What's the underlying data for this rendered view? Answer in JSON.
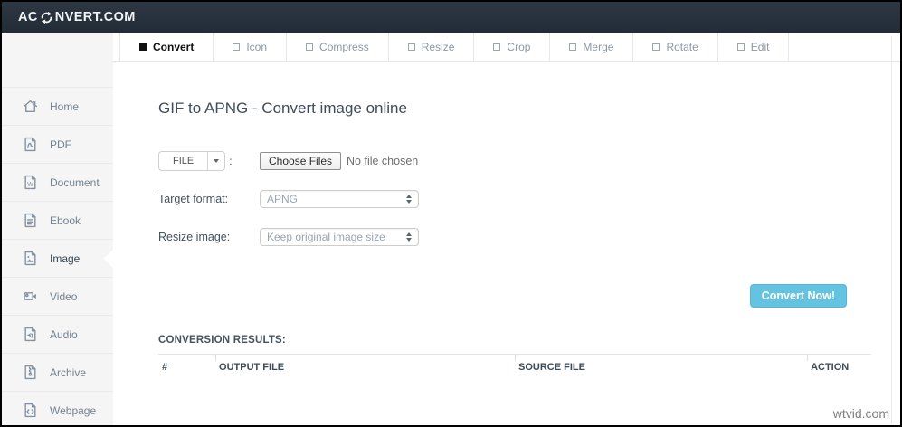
{
  "header": {
    "logo_prefix": "AC",
    "logo_suffix": "NVERT.COM"
  },
  "tabs": [
    {
      "label": "Convert",
      "active": true
    },
    {
      "label": "Icon",
      "active": false
    },
    {
      "label": "Compress",
      "active": false
    },
    {
      "label": "Resize",
      "active": false
    },
    {
      "label": "Crop",
      "active": false
    },
    {
      "label": "Merge",
      "active": false
    },
    {
      "label": "Rotate",
      "active": false
    },
    {
      "label": "Edit",
      "active": false
    }
  ],
  "sidebar": {
    "items": [
      {
        "label": "Home",
        "icon": "home-icon",
        "active": false
      },
      {
        "label": "PDF",
        "icon": "pdf-file-icon",
        "active": false
      },
      {
        "label": "Document",
        "icon": "word-document-icon",
        "active": false
      },
      {
        "label": "Ebook",
        "icon": "ebook-icon",
        "active": false
      },
      {
        "label": "Image",
        "icon": "image-file-icon",
        "active": true
      },
      {
        "label": "Video",
        "icon": "video-camera-icon",
        "active": false
      },
      {
        "label": "Audio",
        "icon": "audio-file-icon",
        "active": false
      },
      {
        "label": "Archive",
        "icon": "archive-zip-icon",
        "active": false
      },
      {
        "label": "Webpage",
        "icon": "webpage-code-icon",
        "active": false
      }
    ]
  },
  "main": {
    "title": "GIF to APNG - Convert image online",
    "file_row": {
      "file_button_label": "FILE",
      "colon": ":",
      "choose_files_label": "Choose Files",
      "no_file_text": "No file chosen"
    },
    "target_format": {
      "label": "Target format:",
      "value": "APNG"
    },
    "resize_image": {
      "label": "Resize image:",
      "value": "Keep original image size"
    },
    "convert_button_label": "Convert Now!",
    "results": {
      "heading": "CONVERSION RESULTS:",
      "columns": {
        "0": "#",
        "1": "OUTPUT FILE",
        "2": "SOURCE FILE",
        "3": "ACTION"
      },
      "rows": []
    }
  },
  "watermark": "wtvid.com",
  "colors": {
    "header_bg": "#273240",
    "sidebar_bg": "#f5f5f6",
    "accent_blue": "#64c3e0",
    "tab_active_text": "#121212",
    "muted_text": "#8b98a6"
  }
}
